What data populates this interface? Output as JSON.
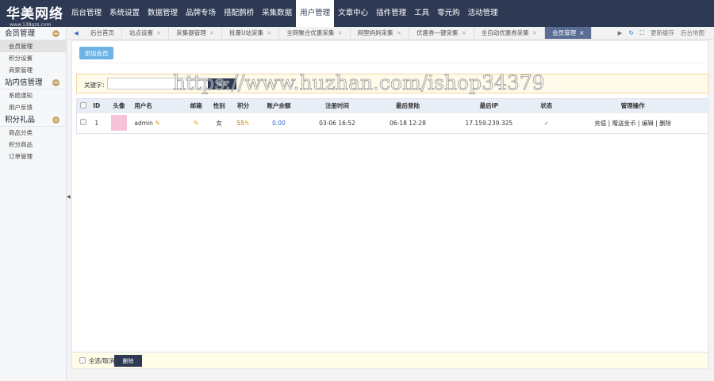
{
  "logo": {
    "title": "华美网络",
    "url": "www.138gzs.com"
  },
  "nav": [
    "后台管理",
    "系统设置",
    "数据管理",
    "品牌专场",
    "搭配鹊桥",
    "采集数据",
    "用户管理",
    "文章中心",
    "插件管理",
    "工具",
    "零元购",
    "活动管理"
  ],
  "sidebar": [
    {
      "title": "会员管理",
      "items": [
        "会员管理",
        "积分设置",
        "商家管理"
      ]
    },
    {
      "title": "站内信管理",
      "items": [
        "系统通知",
        "用户反馈"
      ]
    },
    {
      "title": "积分礼品",
      "items": [
        "商品分类",
        "积分商品",
        "订单管理"
      ]
    }
  ],
  "tabs": [
    "后台首页",
    "站点设置",
    "采集器管理",
    "批量U站采集",
    "全网聚合优惠采集",
    "网里妈妈采集",
    "优惠券一键采集",
    "全自动优惠券采集",
    "会员管理"
  ],
  "tools": {
    "refresh": "更新缓存",
    "map": "后台地图"
  },
  "main": {
    "add_label": "添加会员",
    "keyword_label": "关键字：",
    "keyword_value": "",
    "search_label": "搜索",
    "columns": [
      "ID",
      "头像",
      "用户名",
      "邮箱",
      "性别",
      "积分",
      "账户余额",
      "注册时间",
      "最后登陆",
      "最后IP",
      "状态",
      "管理操作"
    ],
    "rows": [
      {
        "id": "1",
        "username": "admin",
        "email": "",
        "gender": "女",
        "points": "55",
        "balance": "0.00",
        "reg": "03-06 16:52",
        "last": "06-18 12:28",
        "ip": "17.159.239.325",
        "status": "✓",
        "ops": [
          "充值",
          "赠送金币",
          "编辑",
          "删除"
        ]
      }
    ],
    "select_all": "全选/取消",
    "delete_label": "删除"
  },
  "watermark": "https://www.huzhan.com/ishop34379"
}
